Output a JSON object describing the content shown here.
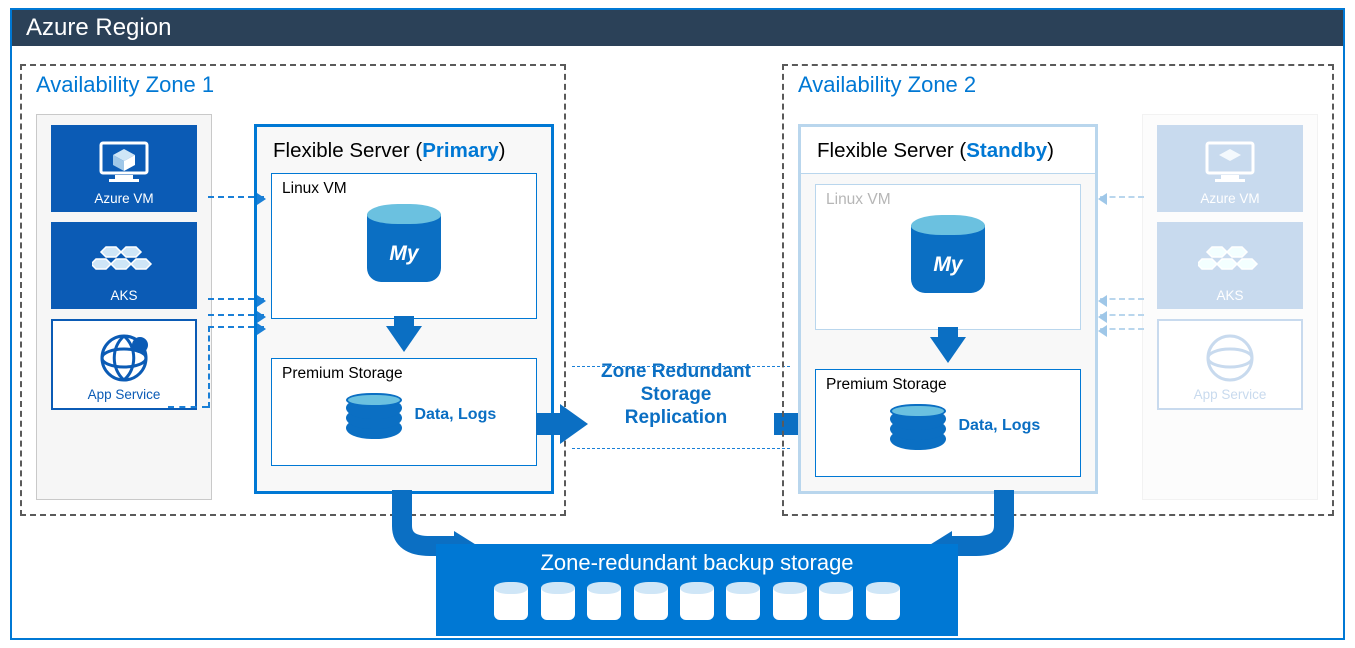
{
  "region": {
    "title": "Azure Region"
  },
  "az1": {
    "title": "Availability Zone 1",
    "flexTitle": "Flexible Server (",
    "primaryLabel": "Primary",
    "closeParen": ")",
    "linux": "Linux VM",
    "mysqlLabel": "My",
    "storage": "Premium Storage",
    "dataLogs": "Data, Logs"
  },
  "az2": {
    "title": "Availability Zone 2",
    "flexTitle": "Flexible Server (",
    "standbyLabel": "Standby",
    "closeParen": ")",
    "linux": "Linux VM",
    "mysqlLabel": "My",
    "storage": "Premium Storage",
    "dataLogs": "Data, Logs"
  },
  "clients": {
    "vm": "Azure VM",
    "aks": "AKS",
    "app": "App Service"
  },
  "mid": "Zone Redundant Storage Replication",
  "backup": "Zone-redundant backup storage"
}
